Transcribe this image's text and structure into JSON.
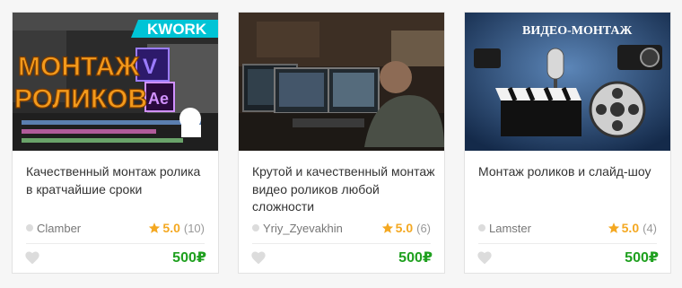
{
  "cards": [
    {
      "thumb_icon": "montage-promo-image",
      "overlay": {
        "brand": "KWORK",
        "line1": "МОНТАЖ",
        "line2": "РОЛИКОВ"
      },
      "title": "Качественный монтаж ролика в кратчайшие сроки",
      "seller": "Clamber",
      "rating": "5.0",
      "reviews": "(10)",
      "price": "500₽"
    },
    {
      "thumb_icon": "video-editor-photo",
      "title": "Крутой и качественный монтаж видео роликов любой сложности",
      "seller": "Yriy_Zyevakhin",
      "rating": "5.0",
      "reviews": "(6)",
      "price": "500₽"
    },
    {
      "thumb_icon": "video-montage-equipment-image",
      "overlay": {
        "caption": "ВИДЕО-МОНТАЖ"
      },
      "title": "Монтаж роликов и слайд-шоу",
      "seller": "Lamster",
      "rating": "5.0",
      "reviews": "(4)",
      "price": "500₽"
    }
  ],
  "colors": {
    "star": "#f4a821",
    "price": "#1fa01f",
    "heart": "#dcdcdc",
    "seller_dot": "#dcdcdc"
  }
}
